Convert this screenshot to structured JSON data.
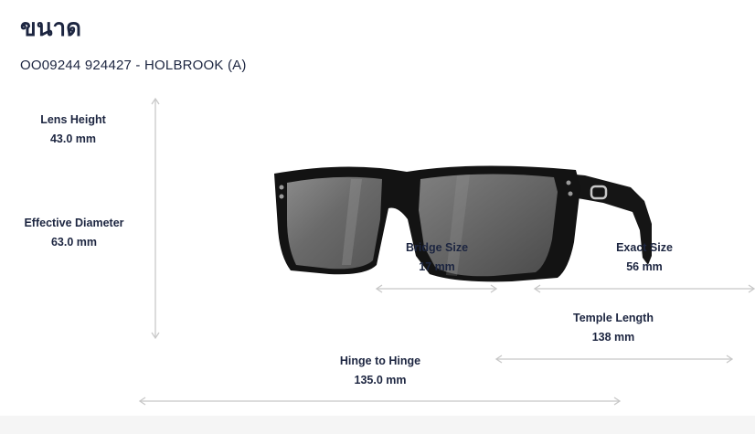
{
  "page": {
    "title": "ขนาด",
    "product": "OO09244 924427 - HOLBROOK (A)"
  },
  "measurements": {
    "lens_height": {
      "label": "Lens Height",
      "value": "43.0 mm"
    },
    "effective_diameter": {
      "label": "Effective Diameter",
      "value": "63.0 mm"
    },
    "bridge_size": {
      "label": "Bridge Size",
      "value": "17 mm"
    },
    "exact_size": {
      "label": "Exact Size",
      "value": "56 mm"
    },
    "temple_length": {
      "label": "Temple Length",
      "value": "138 mm"
    },
    "hinge_to_hinge": {
      "label": "Hinge to Hinge",
      "value": "135.0 mm"
    }
  },
  "colors": {
    "text": "#1c2540",
    "arrow": "#c8c8c8",
    "frame": "#141414",
    "lens": "#6e6e6e"
  },
  "icons": [
    "sunglasses-image",
    "dimension-arrow"
  ]
}
